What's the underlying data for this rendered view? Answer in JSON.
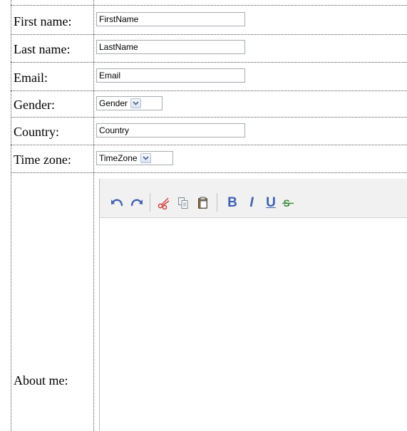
{
  "form": {
    "first_name_label": "First name:",
    "first_name_value": "FirstName",
    "last_name_label": "Last name:",
    "last_name_value": "LastName",
    "email_label": "Email:",
    "email_value": "Email",
    "gender_label": "Gender:",
    "gender_value": "Gender",
    "country_label": "Country:",
    "country_value": "Country",
    "timezone_label": "Time zone:",
    "timezone_value": "TimeZone",
    "about_label": "About me:"
  },
  "editor": {
    "toolbar": [
      "undo-icon",
      "redo-icon",
      "cut-icon",
      "copy-icon",
      "paste-icon",
      "bold-icon",
      "italic-icon",
      "underline-icon",
      "strikethrough-icon"
    ],
    "bold_glyph": "B",
    "italic_glyph": "I",
    "underline_glyph": "U"
  },
  "colors": {
    "icon_blue": "#3f62b3",
    "cut_red": "#d04040",
    "toolbar_bg": "#f1f1f1",
    "field_border": "#a5acb2"
  }
}
